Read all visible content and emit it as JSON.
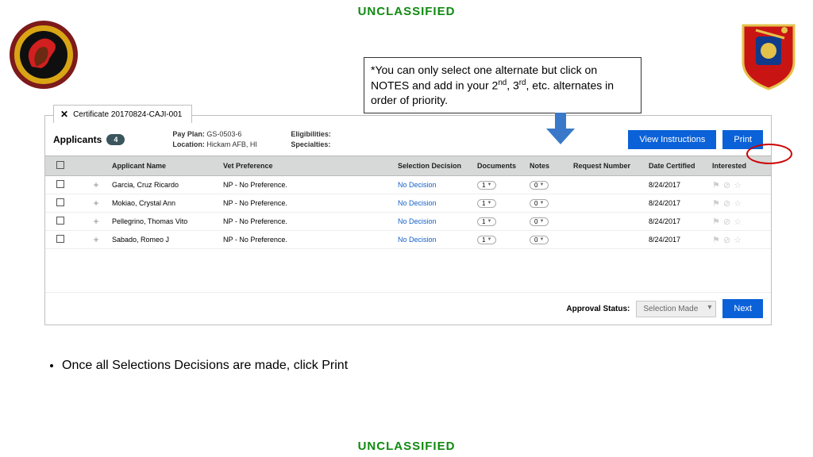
{
  "classification": "UNCLASSIFIED",
  "noteBox": {
    "text1": "*You can only select one alternate but click on NOTES and add in your 2",
    "sup1": "nd",
    "text2": ", 3",
    "sup2": "rd",
    "text3": ", etc. alternates in order of priority."
  },
  "certificate": {
    "tabLabel": "Certificate 20170824-CAJI-001"
  },
  "applicantsHeader": {
    "label": "Applicants",
    "count": "4",
    "payPlanLabel": "Pay Plan:",
    "payPlan": "GS-0503-6",
    "locationLabel": "Location:",
    "location": "Hickam AFB, HI",
    "eligibilitiesLabel": "Eligibilities:",
    "specialtiesLabel": "Specialties:"
  },
  "buttons": {
    "viewInstructions": "View Instructions",
    "print": "Print",
    "next": "Next"
  },
  "columns": {
    "applicantName": "Applicant Name",
    "vetPreference": "Vet Preference",
    "selectionDecision": "Selection Decision",
    "documents": "Documents",
    "notes": "Notes",
    "requestNumber": "Request Number",
    "dateCertified": "Date Certified",
    "interested": "Interested"
  },
  "rows": [
    {
      "name": "Garcia, Cruz Ricardo",
      "vet": "NP - No Preference.",
      "decision": "No Decision",
      "docs": "1",
      "notes": "0",
      "date": "8/24/2017"
    },
    {
      "name": "Mokiao, Crystal Ann",
      "vet": "NP - No Preference.",
      "decision": "No Decision",
      "docs": "1",
      "notes": "0",
      "date": "8/24/2017"
    },
    {
      "name": "Pellegrino, Thomas Vito",
      "vet": "NP - No Preference.",
      "decision": "No Decision",
      "docs": "1",
      "notes": "0",
      "date": "8/24/2017"
    },
    {
      "name": "Sabado, Romeo J",
      "vet": "NP - No Preference.",
      "decision": "No Decision",
      "docs": "1",
      "notes": "0",
      "date": "8/24/2017"
    }
  ],
  "footer": {
    "approvalLabel": "Approval Status:",
    "approvalValue": "Selection Made"
  },
  "bullet": "Once all Selections Decisions are made, click Print"
}
